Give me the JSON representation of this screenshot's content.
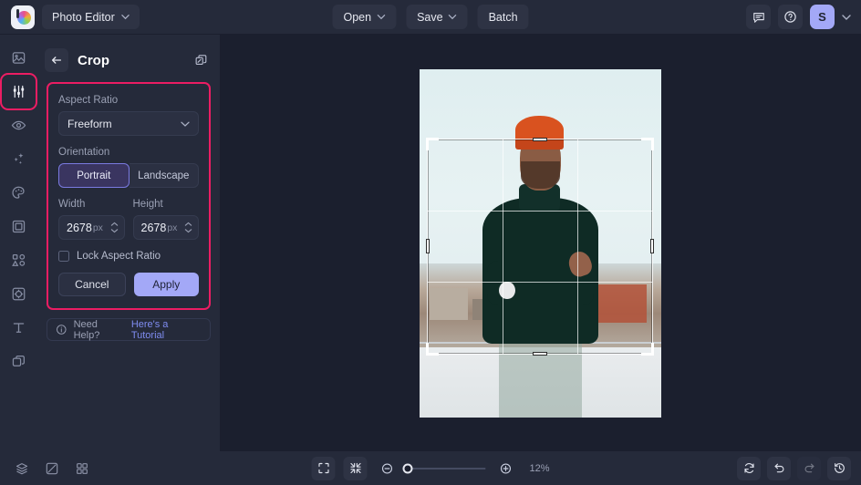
{
  "topbar": {
    "app_chip": {
      "label": "Photo Editor",
      "icon": "chevron-down-icon"
    },
    "logo_icon": "app-logo-icon",
    "center_buttons": [
      {
        "label": "Open",
        "has_chevron": true
      },
      {
        "label": "Save",
        "has_chevron": true
      },
      {
        "label": "Batch",
        "has_chevron": false
      }
    ],
    "right_icons": [
      {
        "name": "feedback-icon"
      },
      {
        "name": "help-icon"
      }
    ],
    "avatar": {
      "initial": "S",
      "color": "#a3a8f7"
    }
  },
  "sidebar": {
    "items": [
      {
        "name": "image-icon",
        "label": "Image",
        "active": false
      },
      {
        "name": "adjust-icon",
        "label": "Adjust",
        "active": true
      },
      {
        "name": "eye-icon",
        "label": "Preview",
        "active": false
      },
      {
        "name": "sparkles-icon",
        "label": "Effects",
        "active": false
      },
      {
        "name": "palette-icon",
        "label": "Color",
        "active": false
      },
      {
        "name": "frame-icon",
        "label": "Frame",
        "active": false
      },
      {
        "name": "shapes-icon",
        "label": "Shapes",
        "active": false
      },
      {
        "name": "retouch-icon",
        "label": "Retouch",
        "active": false
      },
      {
        "name": "text-icon",
        "label": "Text",
        "active": false
      },
      {
        "name": "layers-icon",
        "label": "Layers",
        "active": false
      }
    ],
    "active_highlight_color": "#ec1d63"
  },
  "panel": {
    "title": "Crop",
    "back_icon": "back-arrow-icon",
    "duplicate_icon": "duplicate-layers-icon",
    "highlight_color": "#ec1d63",
    "aspect_ratio": {
      "label": "Aspect Ratio",
      "value": "Freeform",
      "chevron": "chevron-down-icon"
    },
    "orientation": {
      "label": "Orientation",
      "options": [
        "Portrait",
        "Landscape"
      ],
      "selected": "Portrait"
    },
    "width": {
      "label": "Width",
      "value": "2678",
      "unit": "px"
    },
    "height": {
      "label": "Height",
      "value": "2678",
      "unit": "px"
    },
    "lock_aspect": {
      "label": "Lock Aspect Ratio",
      "checked": false
    },
    "buttons": {
      "cancel": "Cancel",
      "apply": "Apply",
      "apply_color": "#a3a8f7"
    }
  },
  "help": {
    "icon": "info-icon",
    "text": "Need Help?",
    "link": "Here's a Tutorial"
  },
  "canvas": {
    "crop_overlay": {
      "grid": "rule-of-thirds",
      "handles": 8
    }
  },
  "bottombar": {
    "left_icons": [
      {
        "name": "layers-stack-icon"
      },
      {
        "name": "compare-icon"
      },
      {
        "name": "grid-view-icon"
      }
    ],
    "center_icons": [
      {
        "name": "fullscreen-icon"
      },
      {
        "name": "fit-screen-icon"
      },
      {
        "name": "zoom-out-icon"
      },
      {
        "name": "zoom-in-icon"
      }
    ],
    "zoom_level": "12%",
    "zoom_slider_position": 0,
    "right_icons": [
      {
        "name": "reset-icon",
        "dim": false
      },
      {
        "name": "undo-icon",
        "dim": false
      },
      {
        "name": "redo-icon",
        "dim": true
      },
      {
        "name": "history-icon",
        "dim": false
      }
    ]
  }
}
